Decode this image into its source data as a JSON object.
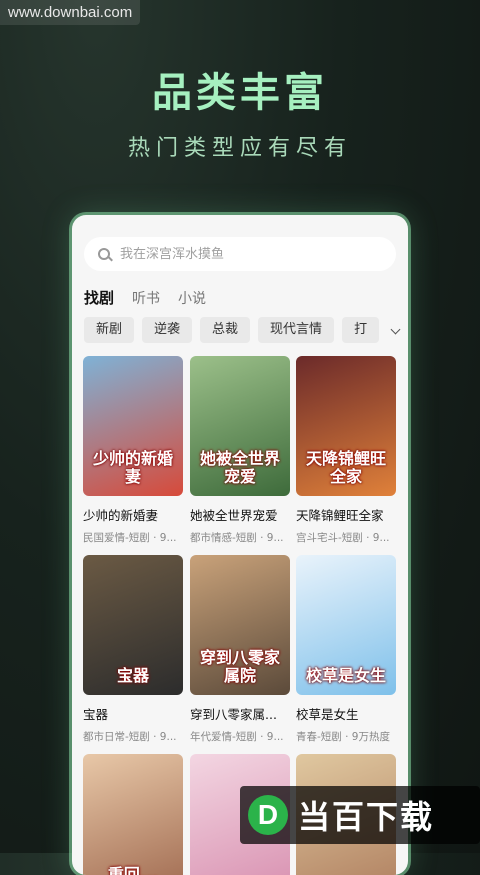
{
  "watermark": "www.downbai.com",
  "headline": "品类丰富",
  "subline": "热门类型应有尽有",
  "search": {
    "placeholder": "我在深宫浑水摸鱼"
  },
  "tabs": [
    {
      "label": "找剧",
      "active": true
    },
    {
      "label": "听书",
      "active": false
    },
    {
      "label": "小说",
      "active": false
    }
  ],
  "chips": [
    "新剧",
    "逆袭",
    "总裁",
    "现代言情",
    "打"
  ],
  "items": [
    {
      "title": "少帅的新婚妻",
      "meta": "民国爱情-短剧 · 9...",
      "poster_text": "少帅的新婚妻",
      "colors": [
        "#d74a3a",
        "#7fb2d6"
      ]
    },
    {
      "title": "她被全世界宠爱",
      "meta": "都市情感-短剧 · 9...",
      "poster_text": "她被全世界宠爱",
      "colors": [
        "#3e6b3b",
        "#9cc08a"
      ]
    },
    {
      "title": "天降锦鲤旺全家",
      "meta": "宫斗宅斗-短剧 · 9...",
      "poster_text": "天降锦鲤旺全家",
      "colors": [
        "#e0813a",
        "#6b2a2a"
      ]
    },
    {
      "title": "宝器",
      "meta": "都市日常-短剧 · 9...",
      "poster_text": "宝器",
      "colors": [
        "#2c2c2c",
        "#6b5a44"
      ]
    },
    {
      "title": "穿到八零家属...",
      "meta": "年代爱情-短剧 · 9...",
      "poster_text": "穿到八零家属院",
      "colors": [
        "#5b4a3a",
        "#c9a27a"
      ]
    },
    {
      "title": "校草是女生",
      "meta": "青春-短剧 · 9万热度",
      "poster_text": "校草是女生",
      "colors": [
        "#7ec0ea",
        "#e9f3fb"
      ]
    },
    {
      "title": "",
      "meta": "",
      "poster_text": "重回...",
      "colors": [
        "#a06a50",
        "#e8c8a8"
      ]
    },
    {
      "title": "",
      "meta": "",
      "poster_text": "",
      "colors": [
        "#d890b0",
        "#f3d6e2"
      ]
    },
    {
      "title": "",
      "meta": "",
      "poster_text": "",
      "colors": [
        "#b08060",
        "#e0c8a0"
      ]
    }
  ],
  "logo": {
    "mark": "D",
    "text": "当百下载"
  }
}
